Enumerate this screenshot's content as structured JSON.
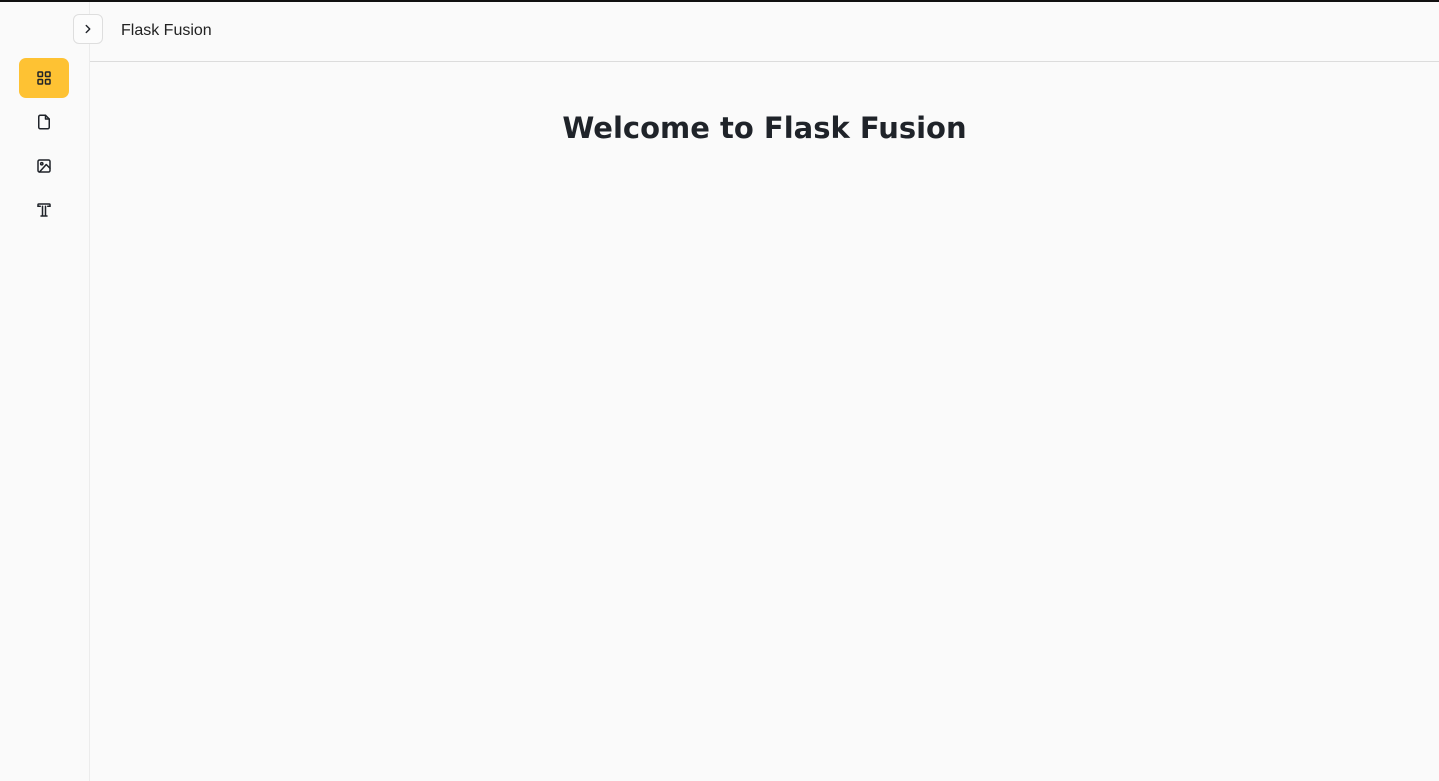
{
  "app": {
    "title": "Flask Fusion"
  },
  "header": {
    "toggle_icon": "chevron-right-icon"
  },
  "sidebar": {
    "items": [
      {
        "icon": "dashboard-grid-icon",
        "active": true
      },
      {
        "icon": "file-icon",
        "active": false
      },
      {
        "icon": "image-icon",
        "active": false
      },
      {
        "icon": "typography-icon",
        "active": false
      }
    ]
  },
  "main": {
    "heading": "Welcome to Flask Fusion"
  },
  "colors": {
    "accent": "#fec233",
    "background": "#fafafa",
    "text": "#1f2329"
  }
}
